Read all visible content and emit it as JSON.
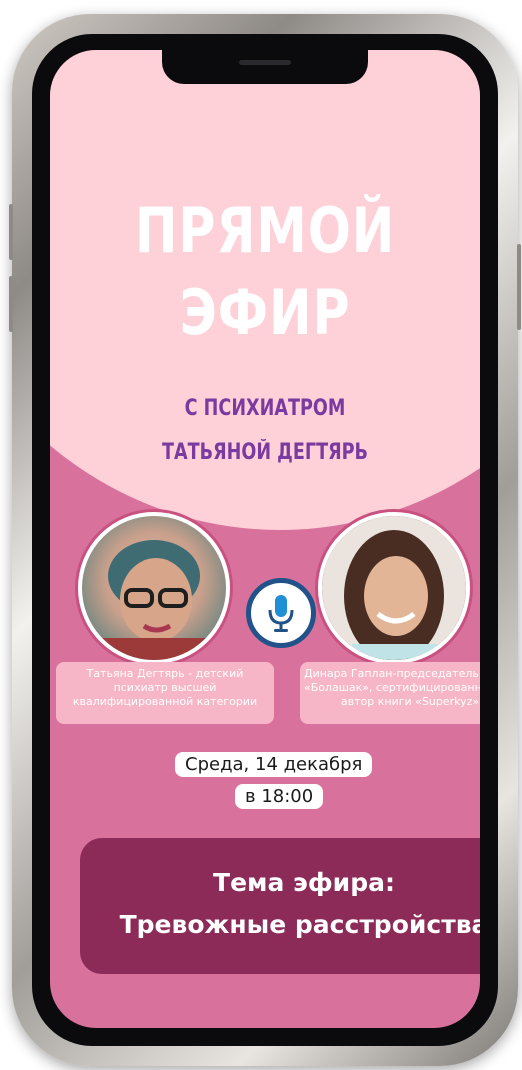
{
  "poster": {
    "title_line1": "ПРЯМОЙ",
    "title_line2": "ЭФИР",
    "subtitle_line1": "С ПСИХИАТРОМ",
    "subtitle_line2": "ТАТЬЯНОЙ ДЕГТЯРЬ",
    "speaker_left": {
      "line1": "Татьяна Дегтярь - детский",
      "line2": "психиатр высшей",
      "line3": "квалифицированной категории"
    },
    "speaker_right": {
      "line1": "Динара Гаплан-председатель фонда",
      "line2": "«Болашак», сертифицированный коуч,",
      "line3": "автор книги «Superkyz»"
    },
    "date_line1": "Среда, 14 декабря",
    "date_line2": "в 18:00",
    "topic_line1": "Тема эфира:",
    "topic_line2": "Тревожные расстройства"
  },
  "colors": {
    "top_background": "#fed0d8",
    "bottom_background": "#d8729c",
    "subtitle": "#7b3aa0",
    "topic_box": "#8c2a58",
    "caption_box": "#f7b6c8",
    "mic_ring": "#21528a"
  },
  "icons": {
    "center_badge": "microphone-icon"
  }
}
